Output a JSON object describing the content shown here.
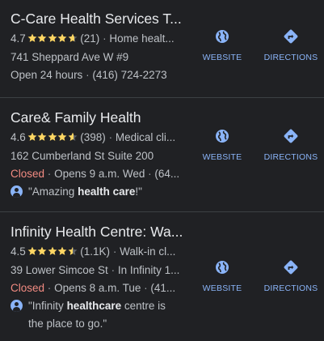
{
  "places": [
    {
      "name": "C-Care Health Services T...",
      "rating": "4.7",
      "stars": 4.7,
      "reviews": "(21)",
      "category": "Home healt...",
      "address": "741 Sheppard Ave W #9",
      "hours_status": "",
      "hours": "Open 24 hours",
      "phone": "(416) 724-2273",
      "review_snippet": null
    },
    {
      "name": "Care& Family Health",
      "rating": "4.6",
      "stars": 4.6,
      "reviews": "(398)",
      "category": "Medical cli...",
      "address": "162 Cumberland St Suite 200",
      "hours_status": "Closed",
      "hours": "Opens 9 a.m. Wed",
      "phone": "(64...",
      "review_snippet": {
        "pre": "\"Amazing ",
        "bold": "health care",
        "post": "!\""
      }
    },
    {
      "name": "Infinity Health Centre: Wa...",
      "rating": "4.5",
      "stars": 4.5,
      "reviews": "(1.1K)",
      "category": "Walk-in cl...",
      "address": "39 Lower Simcoe St",
      "address_extra": "In Infinity 1...",
      "hours_status": "Closed",
      "hours": "Opens 8 a.m. Tue",
      "phone": "(41...",
      "review_snippet": {
        "pre": "\"Infinity ",
        "bold": "healthcare",
        "post": " centre is the place to go.\""
      }
    }
  ],
  "actions": {
    "website_label": "WEBSITE",
    "directions_label": "DIRECTIONS",
    "website_icon": "globe-icon",
    "directions_icon": "directions-icon"
  },
  "separator": "·",
  "colors": {
    "background": "#202124",
    "title": "#e8eaed",
    "text": "#bdc1c6",
    "star": "#fdd663",
    "accent": "#8ab4f8",
    "closed": "#f28b82",
    "divider": "#3c4043"
  }
}
